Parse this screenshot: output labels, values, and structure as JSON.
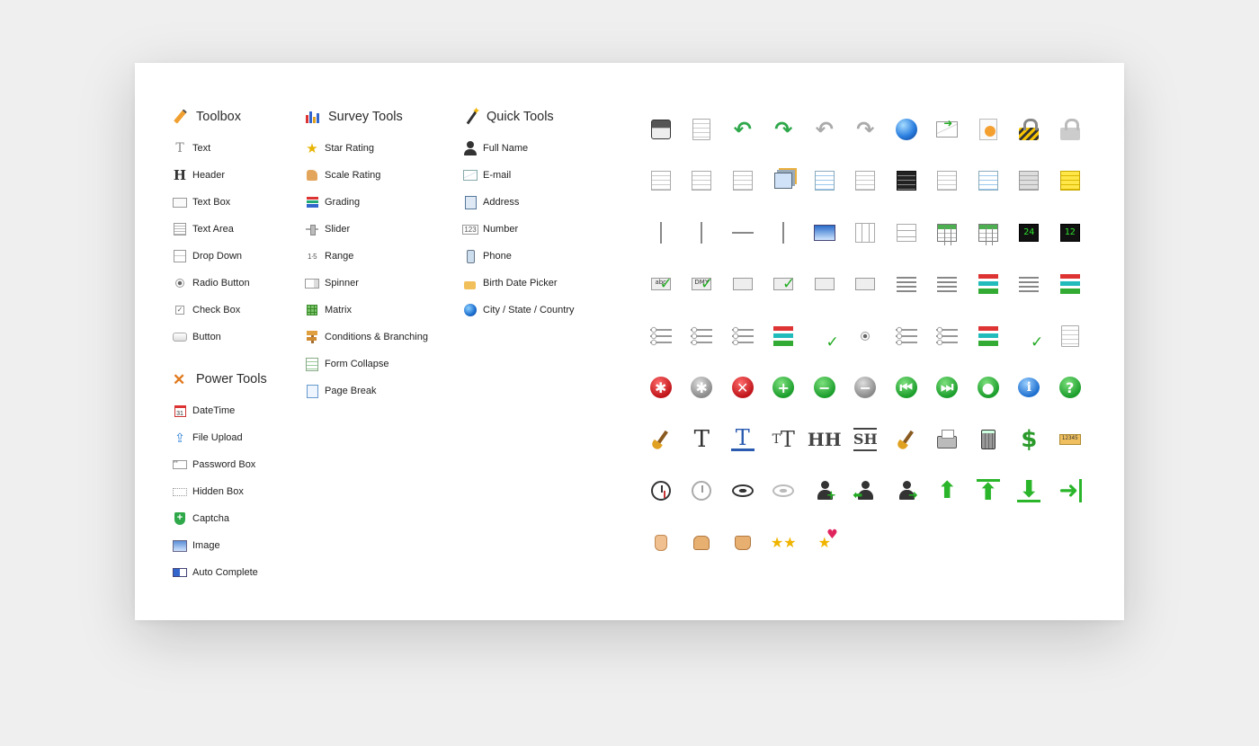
{
  "toolbox": {
    "heading": "Toolbox",
    "items": [
      {
        "label": "Text",
        "icon": "text-icon"
      },
      {
        "label": "Header",
        "icon": "header-icon"
      },
      {
        "label": "Text Box",
        "icon": "textbox-icon"
      },
      {
        "label": "Text Area",
        "icon": "textarea-icon"
      },
      {
        "label": "Drop Down",
        "icon": "dropdown-icon"
      },
      {
        "label": "Radio Button",
        "icon": "radio-icon"
      },
      {
        "label": "Check Box",
        "icon": "checkbox-icon"
      },
      {
        "label": "Button",
        "icon": "button-icon"
      }
    ]
  },
  "power_tools": {
    "heading": "Power Tools",
    "items": [
      {
        "label": "DateTime",
        "icon": "calendar-icon"
      },
      {
        "label": "File Upload",
        "icon": "upload-icon"
      },
      {
        "label": "Password Box",
        "icon": "password-icon"
      },
      {
        "label": "Hidden Box",
        "icon": "hidden-box-icon"
      },
      {
        "label": "Captcha",
        "icon": "shield-icon"
      },
      {
        "label": "Image",
        "icon": "image-icon"
      },
      {
        "label": "Auto Complete",
        "icon": "autocomplete-icon"
      }
    ]
  },
  "survey_tools": {
    "heading": "Survey Tools",
    "items": [
      {
        "label": "Star Rating",
        "icon": "star-icon"
      },
      {
        "label": "Scale Rating",
        "icon": "thumbs-up-icon"
      },
      {
        "label": "Grading",
        "icon": "grading-icon"
      },
      {
        "label": "Slider",
        "icon": "slider-icon"
      },
      {
        "label": "Range",
        "icon": "range-icon"
      },
      {
        "label": "Spinner",
        "icon": "spinner-icon"
      },
      {
        "label": "Matrix",
        "icon": "matrix-icon"
      },
      {
        "label": "Conditions & Branching",
        "icon": "signpost-icon"
      },
      {
        "label": "Form Collapse",
        "icon": "form-collapse-icon"
      },
      {
        "label": "Page Break",
        "icon": "page-break-icon"
      }
    ]
  },
  "quick_tools": {
    "heading": "Quick Tools",
    "items": [
      {
        "label": "Full Name",
        "icon": "person-icon"
      },
      {
        "label": "E-mail",
        "icon": "envelope-icon"
      },
      {
        "label": "Address",
        "icon": "address-book-icon"
      },
      {
        "label": "Number",
        "icon": "number-icon"
      },
      {
        "label": "Phone",
        "icon": "phone-icon"
      },
      {
        "label": "Birth Date Picker",
        "icon": "cake-icon"
      },
      {
        "label": "City / State / Country",
        "icon": "globe-icon"
      }
    ]
  },
  "icon_grid": {
    "text": {
      "abc": "abc",
      "dmy": "DMY",
      "digits_24": "24",
      "digits_12": "12",
      "ruler": "12345",
      "hh": "HH",
      "sh": "SH",
      "calendar": "31",
      "range": "1·5",
      "number": "123",
      "password": "**"
    }
  }
}
